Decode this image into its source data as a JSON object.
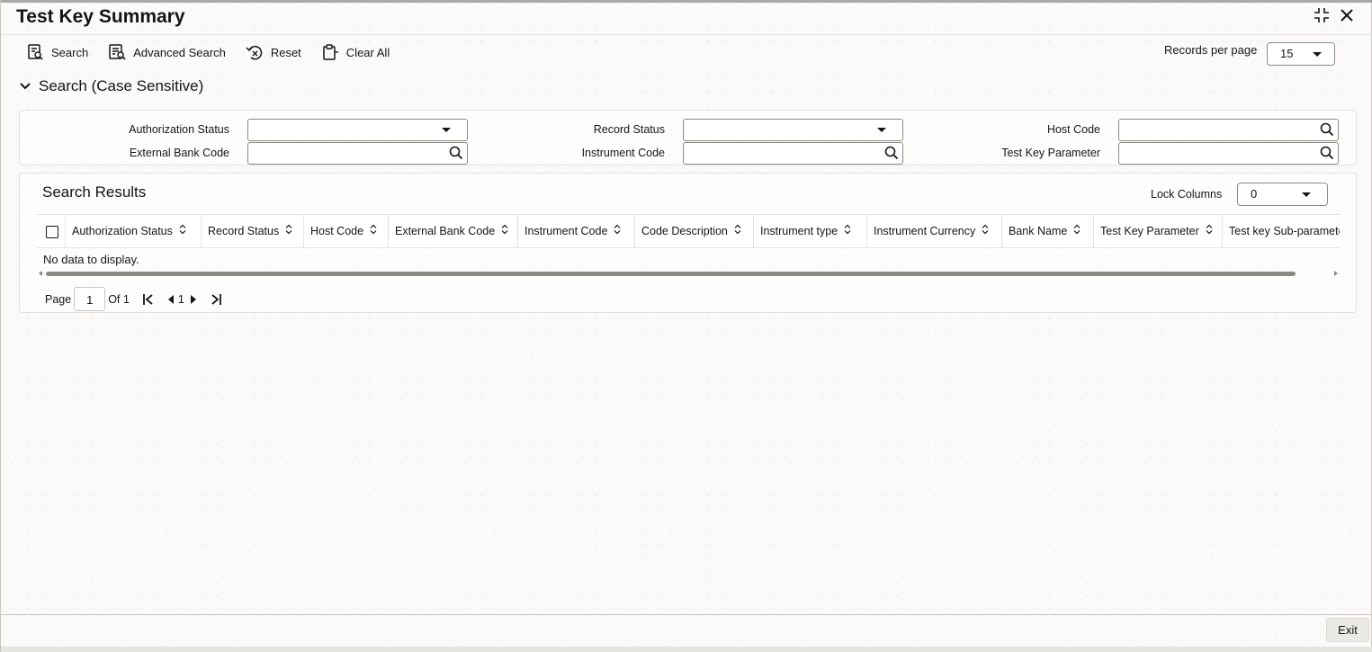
{
  "window": {
    "title": "Test Key Summary"
  },
  "toolbar": {
    "search_label": "Search",
    "advanced_search_label": "Advanced Search",
    "reset_label": "Reset",
    "clear_all_label": "Clear All"
  },
  "records_per_page": {
    "label": "Records per page",
    "value": "15"
  },
  "search_section": {
    "title": "Search (Case Sensitive)",
    "fields": {
      "authorization_status": {
        "label": "Authorization Status",
        "value": ""
      },
      "record_status": {
        "label": "Record Status",
        "value": ""
      },
      "host_code": {
        "label": "Host Code",
        "value": ""
      },
      "external_bank_code": {
        "label": "External Bank Code",
        "value": ""
      },
      "instrument_code": {
        "label": "Instrument Code",
        "value": ""
      },
      "test_key_parameter": {
        "label": "Test Key Parameter",
        "value": ""
      }
    }
  },
  "results": {
    "title": "Search Results",
    "lock_columns": {
      "label": "Lock Columns",
      "value": "0"
    },
    "columns": [
      "Authorization Status",
      "Record Status",
      "Host Code",
      "External Bank Code",
      "Instrument Code",
      "Code Description",
      "Instrument type",
      "Instrument Currency",
      "Bank Name",
      "Test Key Parameter",
      "Test key Sub-parameter"
    ],
    "rows": [],
    "empty_message": "No data to display."
  },
  "pagination": {
    "page_label": "Page",
    "current_page": "1",
    "of_label": "Of 1",
    "page_number": "1"
  },
  "footer": {
    "exit_label": "Exit"
  },
  "colors": {
    "text": "#161513",
    "border": "#8d8a86",
    "divider": "#e4e2df",
    "background": "#fbfaf9"
  },
  "icons": [
    "search-icon",
    "advanced-search-icon",
    "reset-icon",
    "clear-all-icon",
    "minimize-icon",
    "close-icon",
    "chevron-down-icon",
    "magnifier-icon",
    "sort-icon",
    "first-page-icon",
    "prev-page-icon",
    "next-page-icon",
    "last-page-icon"
  ]
}
